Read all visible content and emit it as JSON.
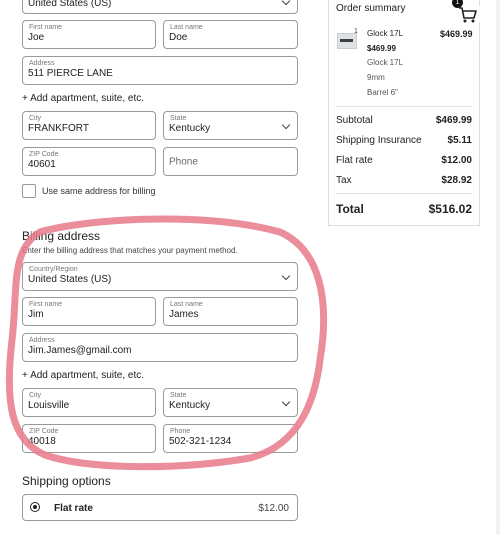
{
  "shipping": {
    "country_value": "United States (US)",
    "first_name_label": "First name",
    "first_name_value": "Joe",
    "last_name_label": "Last name",
    "last_name_value": "Doe",
    "address_label": "Address",
    "address_value": "511 PIERCE LANE",
    "add_apartment": "+ Add apartment, suite, etc.",
    "city_label": "City",
    "city_value": "FRANKFORT",
    "state_label": "State",
    "state_value": "Kentucky",
    "zip_label": "ZIP Code",
    "zip_value": "40601",
    "phone_placeholder": "Phone",
    "same_address_label": "Use same address for billing"
  },
  "billing": {
    "heading": "Billing address",
    "subtext": "Enter the billing address that matches your payment method.",
    "country_label": "Country/Region",
    "country_value": "United States (US)",
    "first_name_label": "First name",
    "first_name_value": "Jim",
    "last_name_label": "Last name",
    "last_name_value": "James",
    "address_label": "Address",
    "address_value": "Jim.James@gmail.com",
    "add_apartment": "+ Add apartment, suite, etc.",
    "city_label": "City",
    "city_value": "Louisville",
    "state_label": "State",
    "state_value": "Kentucky",
    "zip_label": "ZIP Code",
    "zip_value": "40018",
    "phone_label": "Phone",
    "phone_value": "502-321-1234"
  },
  "shipping_options": {
    "heading": "Shipping options",
    "option_label": "Flat rate",
    "option_price": "$12.00"
  },
  "order_summary": {
    "title": "Order summary",
    "cart_count": "1",
    "item": {
      "qty": "1",
      "name": "Glock 17L",
      "price": "$469.99",
      "line_total": "$469.99",
      "variant_name": "Glock 17L",
      "caliber": "9mm",
      "barrel": "Barrel 6\""
    },
    "subtotal_label": "Subtotal",
    "subtotal_value": "$469.99",
    "insurance_label": "Shipping Insurance",
    "insurance_value": "$5.11",
    "flat_rate_label": "Flat rate",
    "flat_rate_value": "$12.00",
    "tax_label": "Tax",
    "tax_value": "$28.92",
    "total_label": "Total",
    "total_value": "$516.02"
  },
  "colors": {
    "highlight_circle": "#e8798a",
    "border": "#9a9a9a"
  }
}
